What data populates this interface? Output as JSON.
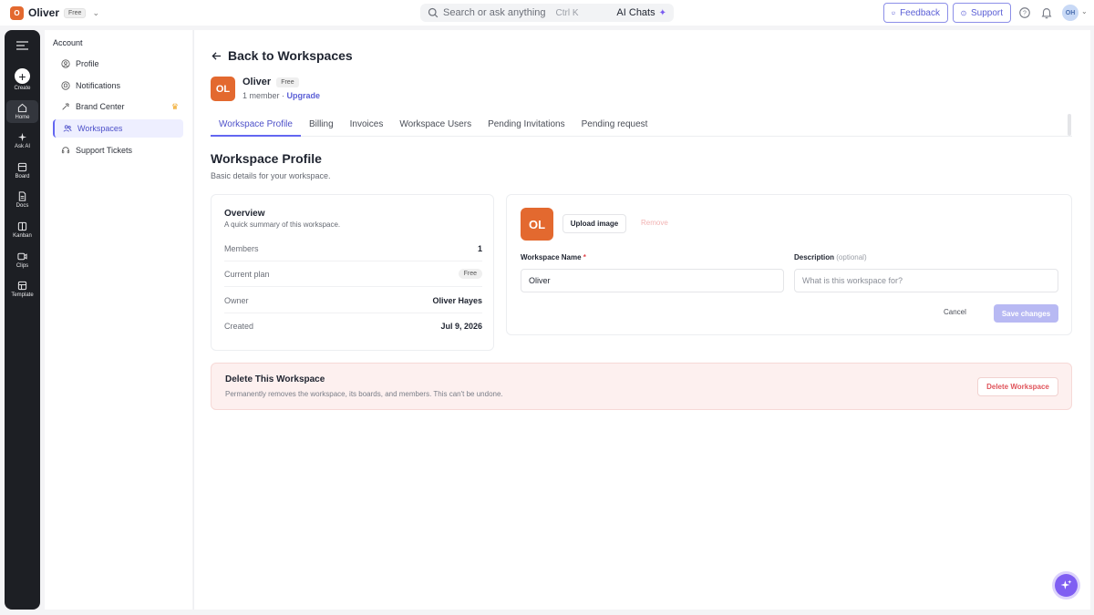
{
  "topbar": {
    "workspace_initial": "O",
    "workspace_name": "Oliver",
    "plan_badge": "Free",
    "search_placeholder": "Search or ask anything",
    "search_shortcut": "Ctrl K",
    "ai_chats_label": "AI Chats",
    "feedback_label": "Feedback",
    "support_label": "Support",
    "user_initials": "OH"
  },
  "rail": {
    "items": [
      {
        "label": "Create",
        "icon": "plus-icon"
      },
      {
        "label": "Home",
        "icon": "home-icon"
      },
      {
        "label": "Ask AI",
        "icon": "sparkle-icon"
      },
      {
        "label": "Board",
        "icon": "board-icon"
      },
      {
        "label": "Docs",
        "icon": "doc-icon"
      },
      {
        "label": "Kanban",
        "icon": "kanban-icon"
      },
      {
        "label": "Clips",
        "icon": "clip-icon"
      },
      {
        "label": "Template",
        "icon": "template-icon"
      }
    ]
  },
  "account_nav": {
    "title": "Account",
    "items": [
      {
        "label": "Profile",
        "icon": "user-circle-icon"
      },
      {
        "label": "Notifications",
        "icon": "bell-icon"
      },
      {
        "label": "Brand Center",
        "icon": "brush-icon"
      },
      {
        "label": "Workspaces",
        "icon": "users-icon"
      },
      {
        "label": "Support Tickets",
        "icon": "headset-icon"
      }
    ],
    "active": "Workspaces"
  },
  "header": {
    "back_label": "Back to Workspaces",
    "workspace_initials": "OL",
    "workspace_name": "Oliver",
    "plan_badge": "Free",
    "member_count": "1 member",
    "separator": "·",
    "upgrade_label": "Upgrade"
  },
  "tabs": [
    {
      "label": "Workspace Profile",
      "active": true
    },
    {
      "label": "Billing"
    },
    {
      "label": "Invoices"
    },
    {
      "label": "Workspace Users"
    },
    {
      "label": "Pending Invitations"
    },
    {
      "label": "Pending request"
    }
  ],
  "section": {
    "title": "Workspace Profile",
    "subtitle": "Basic details for your workspace."
  },
  "overview": {
    "title": "Overview",
    "subtitle": "A quick summary of this workspace.",
    "rows": [
      {
        "label": "Members",
        "value": "1"
      },
      {
        "label": "Current plan",
        "value": "Free"
      },
      {
        "label": "Owner",
        "value": "Oliver Hayes"
      },
      {
        "label": "Created",
        "value": "Jul 9, 2026"
      }
    ]
  },
  "edit_form": {
    "avatar_initials": "OL",
    "upload_label": "Upload image",
    "remove_label": "Remove",
    "name_label": "Workspace Name",
    "required_mark": "*",
    "name_value": "Oliver",
    "description_label": "Description",
    "description_optional": "(optional)",
    "description_placeholder": "What is this workspace for?",
    "cancel_label": "Cancel",
    "save_label": "Save changes"
  },
  "danger_zone": {
    "title": "Delete This Workspace",
    "subtitle": "Permanently removes the workspace, its boards, and members. This can't be undone.",
    "button_label": "Delete Workspace"
  },
  "colors": {
    "accent": "#6366f1",
    "workspace_avatar": "#e3692f",
    "danger": "#e0545b"
  }
}
